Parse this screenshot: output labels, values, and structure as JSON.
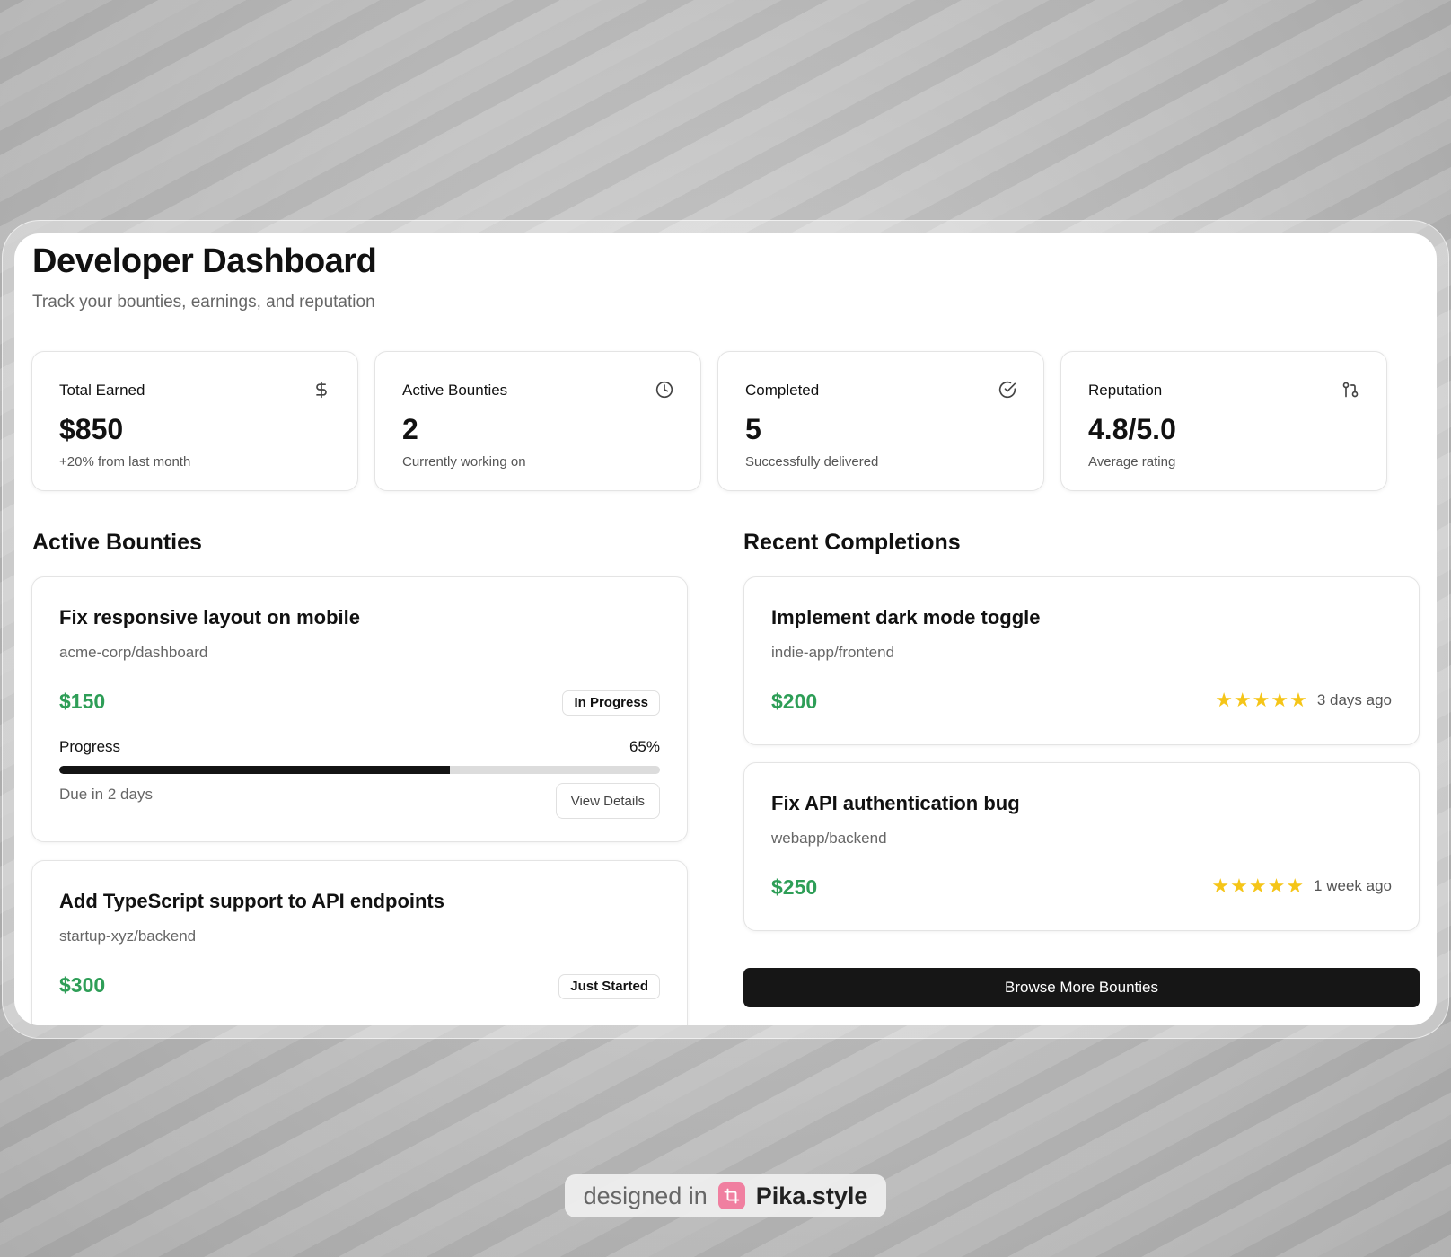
{
  "header": {
    "title": "Developer Dashboard",
    "subtitle": "Track your bounties, earnings, and reputation"
  },
  "stats": [
    {
      "label": "Total Earned",
      "value": "$850",
      "sub": "+20% from last month",
      "icon": "dollar-icon"
    },
    {
      "label": "Active Bounties",
      "value": "2",
      "sub": "Currently working on",
      "icon": "clock-icon"
    },
    {
      "label": "Completed",
      "value": "5",
      "sub": "Successfully delivered",
      "icon": "check-circle-icon"
    },
    {
      "label": "Reputation",
      "value": "4.8/5.0",
      "sub": "Average rating",
      "icon": "git-pull-request-icon"
    }
  ],
  "active_section": {
    "title": "Active Bounties",
    "items": [
      {
        "title": "Fix responsive layout on mobile",
        "repo": "acme-corp/dashboard",
        "amount": "$150",
        "status": "In Progress",
        "progress_label": "Progress",
        "progress_text": "65%",
        "progress": 0.65,
        "due": "Due in 2 days",
        "action": "View Details"
      },
      {
        "title": "Add TypeScript support to API endpoints",
        "repo": "startup-xyz/backend",
        "amount": "$300",
        "status": "Just Started"
      }
    ]
  },
  "recent_section": {
    "title": "Recent Completions",
    "items": [
      {
        "title": "Implement dark mode toggle",
        "repo": "indie-app/frontend",
        "amount": "$200",
        "rating": 5,
        "ago": "3 days ago"
      },
      {
        "title": "Fix API authentication bug",
        "repo": "webapp/backend",
        "amount": "$250",
        "rating": 5,
        "ago": "1 week ago"
      }
    ],
    "browse_label": "Browse More Bounties"
  },
  "credit": {
    "prefix": "designed in",
    "brand": "Pika.style",
    "icon": "pika-logo-icon"
  },
  "colors": {
    "accent_green": "#2e9e57",
    "star": "#f5c518",
    "primary_button": "#161616"
  }
}
